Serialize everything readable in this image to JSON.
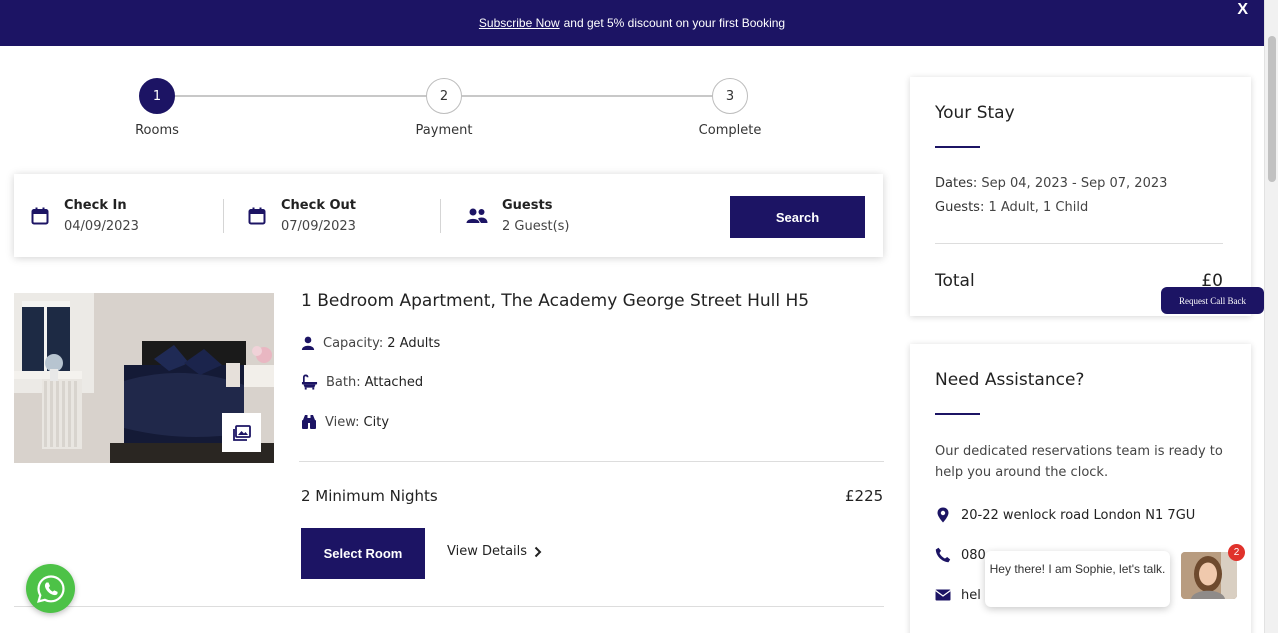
{
  "banner": {
    "link": "Subscribe Now",
    "text": "and get 5% discount on your first Booking",
    "close": "X"
  },
  "steps": [
    {
      "num": "1",
      "label": "Rooms"
    },
    {
      "num": "2",
      "label": "Payment"
    },
    {
      "num": "3",
      "label": "Complete"
    }
  ],
  "search": {
    "check_in_label": "Check In",
    "check_in_value": "04/09/2023",
    "check_out_label": "Check Out",
    "check_out_value": "07/09/2023",
    "guests_label": "Guests",
    "guests_value": "2 Guest(s)",
    "button": "Search"
  },
  "room": {
    "title": "1 Bedroom Apartment, The Academy George Street Hull H5",
    "capacity_label": "Capacity:",
    "capacity_value": "2 Adults",
    "bath_label": "Bath:",
    "bath_value": "Attached",
    "view_label": "View:",
    "view_value": "City",
    "min_nights": "2 Minimum Nights",
    "price": "£225",
    "select_button": "Select Room",
    "details_link": "View Details"
  },
  "stay": {
    "title": "Your Stay",
    "dates_label": "Dates:",
    "dates_value": "Sep 04, 2023 - Sep 07, 2023",
    "guests_label": "Guests:",
    "guests_value": "1 Adult, 1 Child",
    "total_label": "Total",
    "total_value": "£0"
  },
  "callback": "Request Call Back",
  "assist": {
    "title": "Need Assistance?",
    "text": "Our dedicated reservations team is ready to help you around the clock.",
    "address": "20-22 wenlock road London N1 7GU",
    "phone": "080",
    "email": "hel"
  },
  "chat": {
    "message": "Hey there! I am Sophie, let's talk.",
    "badge": "2"
  },
  "colors": {
    "brand": "#1c1464",
    "whatsapp": "#4dc247",
    "badge": "#e0322b"
  },
  "icons": [
    "calendar-icon",
    "users-icon",
    "user-icon",
    "bath-icon",
    "binoculars-icon",
    "gallery-icon",
    "chevron-right-icon",
    "map-pin-icon",
    "phone-icon",
    "mail-icon",
    "whatsapp-icon"
  ]
}
